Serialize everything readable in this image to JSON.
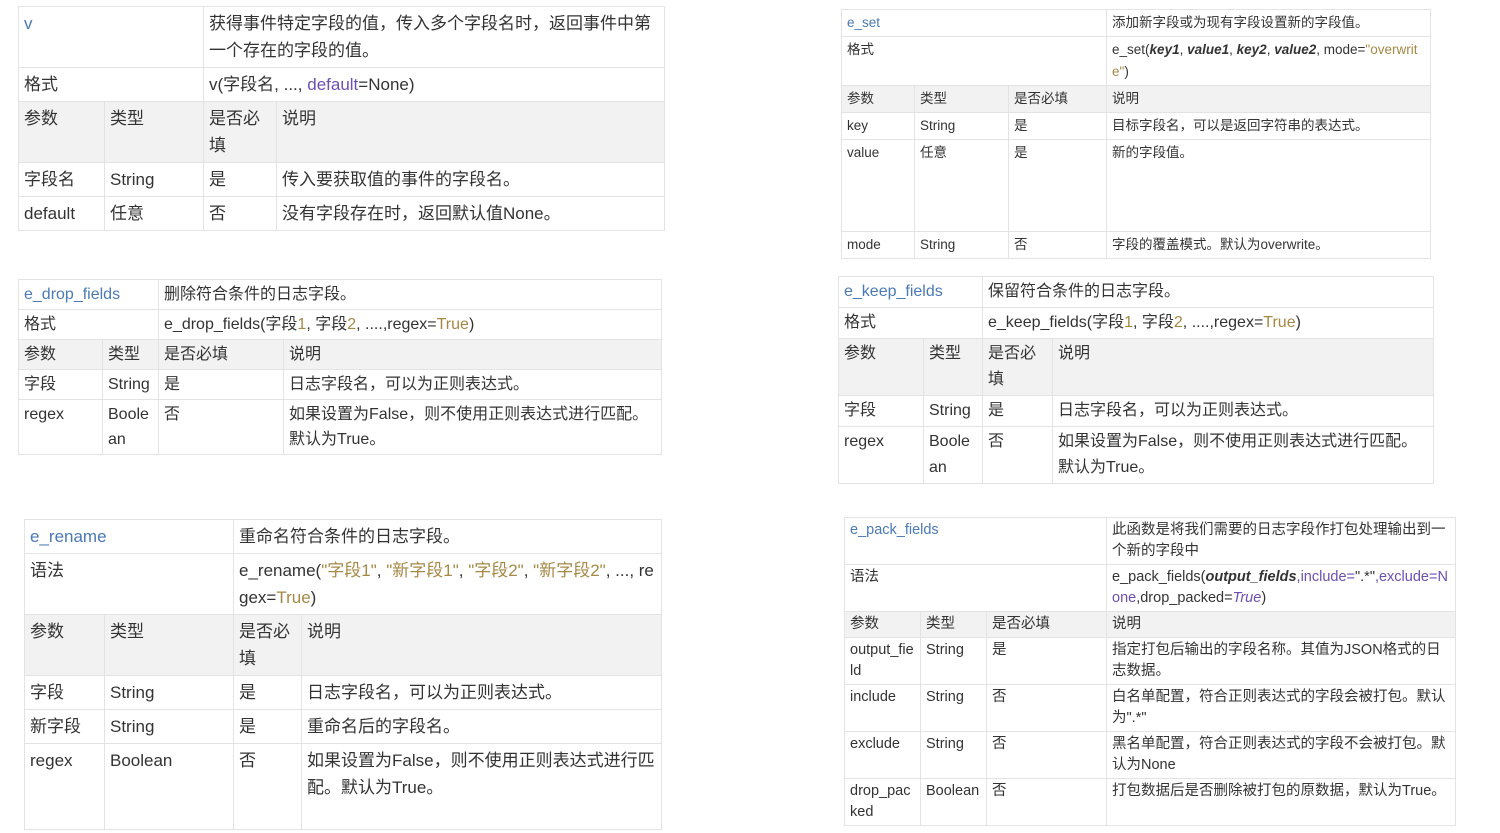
{
  "v": {
    "name": "v",
    "desc": "获得事件特定字段的值，传入多个字段名时，返回事件中第一个存在的字段的值。",
    "format_label": "格式",
    "format": {
      "fn": "v(字段名, ..., ",
      "kw": "default",
      "rest": "=None)"
    },
    "headers": [
      "参数",
      "类型",
      "是否必填",
      "说明"
    ],
    "rows": [
      {
        "param": "字段名",
        "type": "String",
        "required": "是",
        "desc": "传入要获取值的事件的字段名。"
      },
      {
        "param": "default",
        "type": "任意",
        "required": "否",
        "desc": "没有字段存在时，返回默认值None。"
      }
    ]
  },
  "e_set": {
    "name": "e_set",
    "desc": "添加新字段或为现有字段设置新的字段值。",
    "format_label": "格式",
    "format": {
      "fn": "e_set(",
      "a1": "key1",
      "s1": ", ",
      "a2": "value1",
      "s2": ", ",
      "a3": "key2",
      "s3": ", ",
      "a4": "value2",
      "s4": ", mode=",
      "str": "\"overwrite\"",
      "end": ")"
    },
    "headers": [
      "参数",
      "类型",
      "是否必填",
      "说明"
    ],
    "rows": [
      {
        "param": "key",
        "type": "String",
        "required": "是",
        "desc": "目标字段名，可以是返回字符串的表达式。"
      },
      {
        "param": "value",
        "type": "任意",
        "required": "是",
        "desc": "新的字段值。"
      },
      {
        "param": "mode",
        "type": "String",
        "required": "否",
        "desc": "字段的覆盖模式。默认为overwrite。"
      }
    ]
  },
  "e_drop_fields": {
    "name": "e_drop_fields",
    "desc": "删除符合条件的日志字段。",
    "format_label": "格式",
    "format": {
      "a": "e_drop_fields(字段",
      "n1": "1",
      "b": ", 字段",
      "n2": "2",
      "c": ", ....,regex=",
      "t": "True",
      "d": ")"
    },
    "headers": [
      "参数",
      "类型",
      "是否必填",
      "说明"
    ],
    "rows": [
      {
        "param": "字段",
        "type": "String",
        "required": "是",
        "desc": "日志字段名，可以为正则表达式。"
      },
      {
        "param": "regex",
        "type": "Boolean",
        "required": "否",
        "desc": "如果设置为False，则不使用正则表达式进行匹配。默认为True。"
      }
    ]
  },
  "e_keep_fields": {
    "name": "e_keep_fields",
    "desc": "保留符合条件的日志字段。",
    "format_label": "格式",
    "format": {
      "a": "e_keep_fields(字段",
      "n1": "1",
      "b": ", 字段",
      "n2": "2",
      "c": ", ....,regex=",
      "t": "True",
      "d": ")"
    },
    "headers": [
      "参数",
      "类型",
      "是否必填",
      "说明"
    ],
    "rows": [
      {
        "param": "字段",
        "type": "String",
        "required": "是",
        "desc": "日志字段名，可以为正则表达式。"
      },
      {
        "param": "regex",
        "type": "Boolean",
        "required": "否",
        "desc": "如果设置为False，则不使用正则表达式进行匹配。默认为True。"
      }
    ]
  },
  "e_rename": {
    "name": "e_rename",
    "desc": "重命名符合条件的日志字段。",
    "syntax_label": "语法",
    "syntax": {
      "fn": "e_rename(",
      "s1": "\"字段1\"",
      "c1": ", ",
      "s2": "\"新字段1\"",
      "c2": ", ",
      "s3": "\"字段2\"",
      "c3": ", ",
      "s4": "\"新字段2\"",
      "c4": ", ..., regex=",
      "t": "True",
      "end": ")"
    },
    "headers": [
      "参数",
      "类型",
      "是否必填",
      "说明"
    ],
    "rows": [
      {
        "param": "字段",
        "type": "String",
        "required": "是",
        "desc": "日志字段名，可以为正则表达式。"
      },
      {
        "param": "新字段",
        "type": "String",
        "required": "是",
        "desc": "重命名后的字段名。"
      },
      {
        "param": "regex",
        "type": "Boolean",
        "required": "否",
        "desc": "如果设置为False，则不使用正则表达式进行匹配。默认为True。"
      }
    ]
  },
  "e_pack_fields": {
    "name": "e_pack_fields",
    "desc": "此函数是将我们需要的日志字段作打包处理输出到一个新的字段中",
    "syntax_label": "语法",
    "syntax": {
      "fn": "e_pack_fields(",
      "a1": "output_fields",
      "k1": ",include=",
      "v1": "\".*\"",
      "k2": ",exclude=",
      "v2": "None",
      "k3": ",drop_packed=",
      "t": "True",
      "end": ")"
    },
    "headers": [
      "参数",
      "类型",
      "是否必填",
      "说明"
    ],
    "rows": [
      {
        "param": "output_field",
        "type": "String",
        "required": "是",
        "desc": "指定打包后输出的字段名称。其值为JSON格式的日志数据。"
      },
      {
        "param": "include",
        "type": "String",
        "required": "否",
        "desc": "白名单配置，符合正则表达式的字段会被打包。默认为\".*\""
      },
      {
        "param": "exclude",
        "type": "String",
        "required": "否",
        "desc": "黑名单配置，符合正则表达式的字段不会被打包。默认为None"
      },
      {
        "param": "drop_packed",
        "type": "Boolean",
        "required": "否",
        "desc": "打包数据后是否删除被打包的原数据，默认为True。"
      }
    ]
  }
}
